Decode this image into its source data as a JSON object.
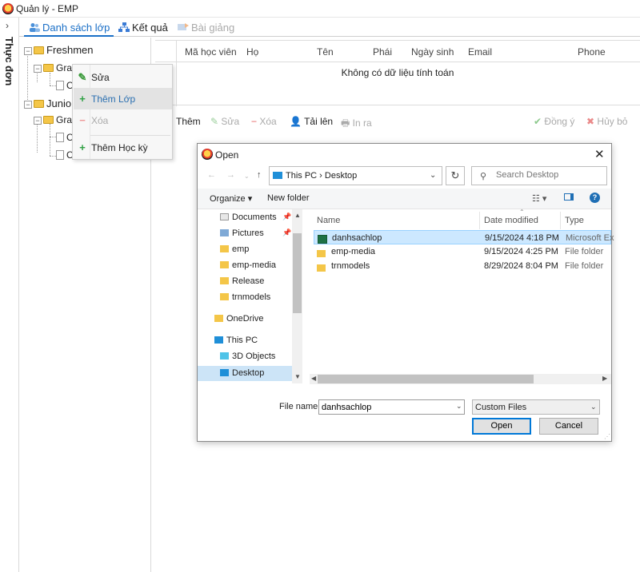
{
  "window": {
    "title": "Quản lý - EMP"
  },
  "rail": {
    "expand_glyph": "›",
    "label": "Thực đơn"
  },
  "tabs": [
    {
      "label": "Danh sách lớp",
      "icon": "users-icon"
    },
    {
      "label": "Kết quả",
      "icon": "hierarchy-icon"
    },
    {
      "label": "Bài giảng",
      "icon": "lecture-icon"
    }
  ],
  "tree": {
    "freshmen": "Freshmen",
    "fresh_grade": "Gra",
    "fresh_class": "C",
    "junior": "Junior",
    "junior_grade": "Gra",
    "junior_class1": "C",
    "junior_class2": "C"
  },
  "context_menu": {
    "edit": "Sửa",
    "add_class": "Thêm Lớp",
    "delete": "Xóa",
    "add_semester": "Thêm Học kỳ"
  },
  "grid": {
    "columns": [
      "Mã học viên",
      "Họ",
      "Tên",
      "Phái",
      "Ngày sinh",
      "Email",
      "Phone"
    ],
    "empty_message": "Không có dữ liệu tính toán"
  },
  "toolbar": {
    "add": "Thêm",
    "edit": "Sửa",
    "delete": "Xóa",
    "upload": "Tải lên",
    "print": "In ra",
    "accept": "Đồng ý",
    "cancel": "Hủy bỏ"
  },
  "dialog": {
    "title": "Open",
    "close_glyph": "✕",
    "address": "This PC  ›  Desktop",
    "search_placeholder": "Search Desktop",
    "organize": "Organize ▾",
    "new_folder": "New folder",
    "nav_items": [
      "Documents",
      "Pictures",
      "emp",
      "emp-media",
      "Release",
      "trnmodels",
      "OneDrive",
      "This PC",
      "3D Objects",
      "Desktop"
    ],
    "columns": {
      "name": "Name",
      "date": "Date modified",
      "type": "Type"
    },
    "files": [
      {
        "name": "danhsachlop",
        "date": "9/15/2024 4:18 PM",
        "type": "Microsoft Ex"
      },
      {
        "name": "emp-media",
        "date": "9/15/2024 4:25 PM",
        "type": "File folder"
      },
      {
        "name": "trnmodels",
        "date": "8/29/2024 8:04 PM",
        "type": "File folder"
      }
    ],
    "file_name_label": "File name:",
    "file_name_value": "danhsachlop",
    "file_type": "Custom Files",
    "open_button": "Open",
    "cancel_button": "Cancel"
  },
  "colors": {
    "accent": "#1a6fc7",
    "selection": "#cce8ff",
    "add_green": "#2ea043",
    "delete_red": "#e05a5a"
  }
}
